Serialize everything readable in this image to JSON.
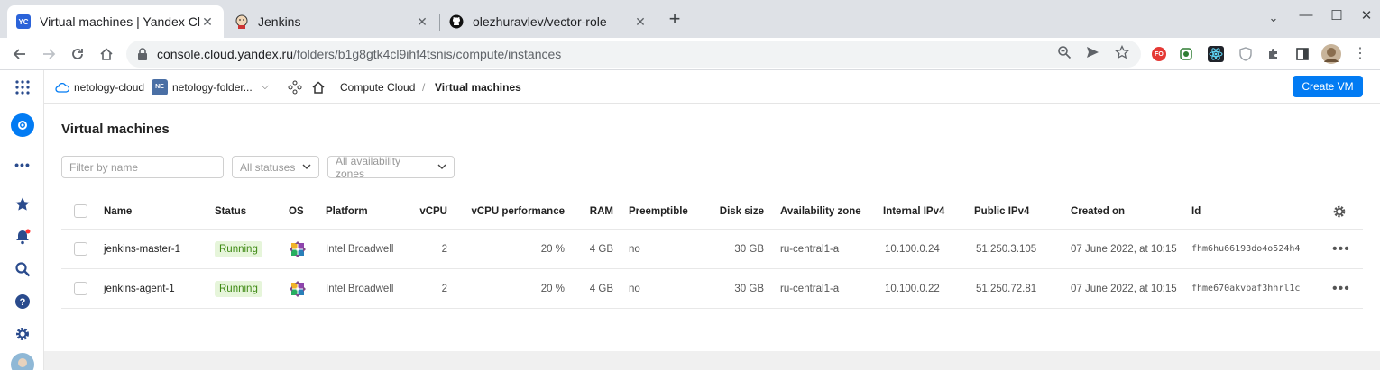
{
  "browser": {
    "tabs": [
      {
        "title": "Virtual machines | Yandex Clo",
        "favicon": "YC",
        "active": true
      },
      {
        "title": "Jenkins",
        "favicon": "jenkins-icon",
        "active": false
      },
      {
        "title": "olezhuravlev/vector-role",
        "favicon": "github-icon",
        "active": false
      }
    ],
    "url_host": "console.cloud.yandex.ru",
    "url_path": "/folders/b1g8gtk4cl9ihf4tsnis/compute/instances",
    "ext_badge": "FO"
  },
  "header": {
    "cloud": "netology-cloud",
    "folder_badge": "NE",
    "folder": "netology-folder...",
    "service": "Compute Cloud",
    "separator": "/",
    "page": "Virtual machines",
    "create_label": "Create VM"
  },
  "main": {
    "title": "Virtual machines",
    "filter_placeholder": "Filter by name",
    "status_filter": "All statuses",
    "zone_filter": "All availability zones"
  },
  "table": {
    "columns": {
      "name": "Name",
      "status": "Status",
      "os": "OS",
      "platform": "Platform",
      "vcpu": "vCPU",
      "perf": "vCPU performance",
      "ram": "RAM",
      "preemptible": "Preemptible",
      "disk": "Disk size",
      "zone": "Availability zone",
      "internal": "Internal IPv4",
      "public": "Public IPv4",
      "created": "Created on",
      "id": "Id"
    },
    "rows": [
      {
        "name": "jenkins-master-1",
        "status": "Running",
        "platform": "Intel Broadwell",
        "vcpu": "2",
        "perf": "20 %",
        "ram": "4 GB",
        "preemptible": "no",
        "disk": "30 GB",
        "zone": "ru-central1-a",
        "internal": "10.100.0.24",
        "public": "51.250.3.105",
        "created": "07 June 2022, at 10:15",
        "id": "fhm6hu66193do4o524h4"
      },
      {
        "name": "jenkins-agent-1",
        "status": "Running",
        "platform": "Intel Broadwell",
        "vcpu": "2",
        "perf": "20 %",
        "ram": "4 GB",
        "preemptible": "no",
        "disk": "30 GB",
        "zone": "ru-central1-a",
        "internal": "10.100.0.22",
        "public": "51.250.72.81",
        "created": "07 June 2022, at 10:15",
        "id": "fhme670akvbaf3hhrl1c"
      }
    ]
  },
  "colors": {
    "accent": "#027bf3",
    "running_bg": "#e6f5da",
    "running_text": "#3f8a14"
  }
}
